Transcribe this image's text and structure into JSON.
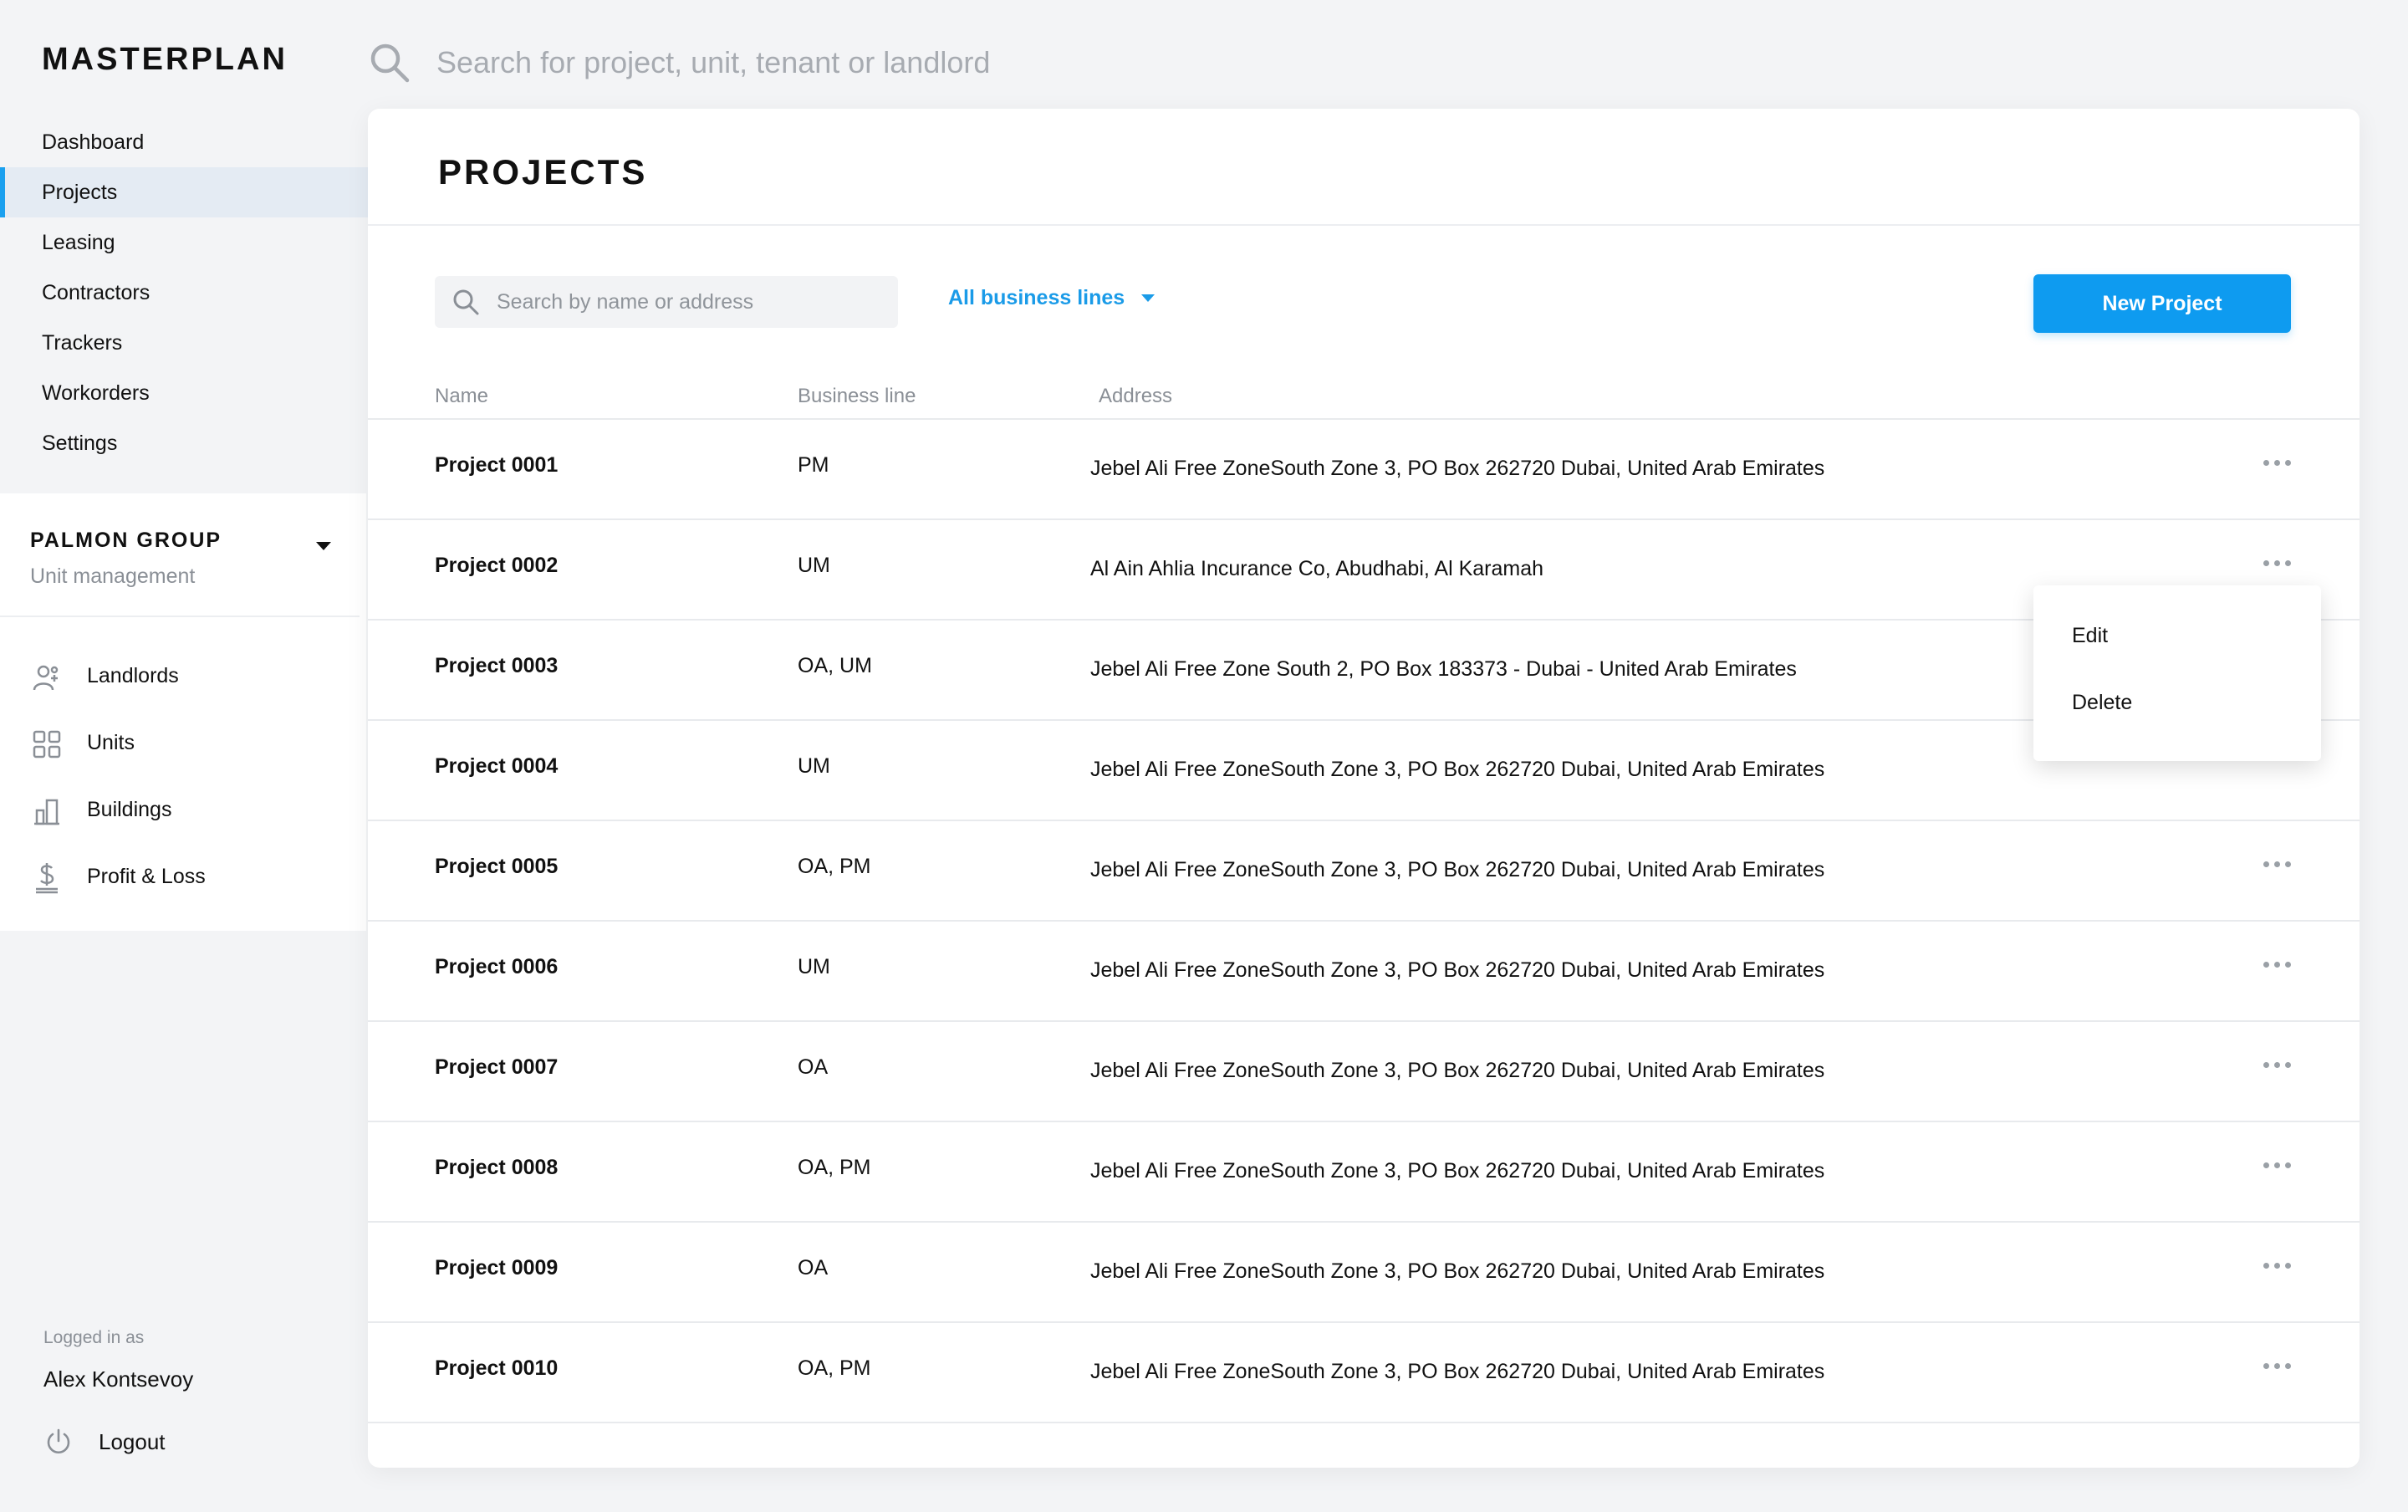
{
  "app": {
    "title": "MASTERPLAN"
  },
  "top_search": {
    "placeholder": "Search for project, unit, tenant or landlord",
    "icon": "search-icon"
  },
  "nav": {
    "items": [
      {
        "label": "Dashboard",
        "active": false
      },
      {
        "label": "Projects",
        "active": true
      },
      {
        "label": "Leasing",
        "active": false
      },
      {
        "label": "Contractors",
        "active": false
      },
      {
        "label": "Trackers",
        "active": false
      },
      {
        "label": "Workorders",
        "active": false
      },
      {
        "label": "Settings",
        "active": false
      }
    ],
    "active_color": "#1aa0ef"
  },
  "org": {
    "name": "PALMON GROUP",
    "subtitle": "Unit management",
    "links": [
      {
        "label": "Landlords",
        "icon": "landlords-icon"
      },
      {
        "label": "Units",
        "icon": "units-grid-icon"
      },
      {
        "label": "Buildings",
        "icon": "buildings-icon"
      },
      {
        "label": "Profit & Loss",
        "icon": "dollar-icon"
      }
    ]
  },
  "user": {
    "logged_in_label": "Logged in as",
    "name": "Alex Kontsevoy",
    "logout_label": "Logout"
  },
  "main": {
    "title": "PROJECTS",
    "filter_search_placeholder": "Search by name or address",
    "business_line_filter": "All business lines",
    "new_project_label": "New Project",
    "accent_color": "#0e9bf0",
    "columns": {
      "name": "Name",
      "business_line": "Business line",
      "address": "Address"
    },
    "rows": [
      {
        "name": "Project 0001",
        "business_line": "PM",
        "address": "Jebel Ali Free ZoneSouth Zone 3, PO Box 262720 Dubai, United Arab Emirates"
      },
      {
        "name": "Project 0002",
        "business_line": "UM",
        "address": "Al Ain Ahlia Incurance Co, Abudhabi, Al Karamah"
      },
      {
        "name": "Project 0003",
        "business_line": "OA, UM",
        "address": "Jebel Ali Free Zone South 2, PO Box 183373 - Dubai - United Arab Emirates"
      },
      {
        "name": "Project 0004",
        "business_line": "UM",
        "address": "Jebel Ali Free ZoneSouth Zone 3, PO Box 262720 Dubai, United Arab Emirates"
      },
      {
        "name": "Project 0005",
        "business_line": "OA, PM",
        "address": "Jebel Ali Free ZoneSouth Zone 3, PO Box 262720 Dubai, United Arab Emirates"
      },
      {
        "name": "Project 0006",
        "business_line": "UM",
        "address": "Jebel Ali Free ZoneSouth Zone 3, PO Box 262720 Dubai, United Arab Emirates"
      },
      {
        "name": "Project 0007",
        "business_line": "OA",
        "address": "Jebel Ali Free ZoneSouth Zone 3, PO Box 262720 Dubai, United Arab Emirates"
      },
      {
        "name": "Project 0008",
        "business_line": "OA, PM",
        "address": "Jebel Ali Free ZoneSouth Zone 3, PO Box 262720 Dubai, United Arab Emirates"
      },
      {
        "name": "Project 0009",
        "business_line": "OA",
        "address": "Jebel Ali Free ZoneSouth Zone 3, PO Box 262720 Dubai, United Arab Emirates"
      },
      {
        "name": "Project 0010",
        "business_line": "OA, PM",
        "address": "Jebel Ali Free ZoneSouth Zone 3, PO Box 262720 Dubai, United Arab Emirates"
      }
    ],
    "context_menu": {
      "edit_label": "Edit",
      "delete_label": "Delete"
    }
  }
}
